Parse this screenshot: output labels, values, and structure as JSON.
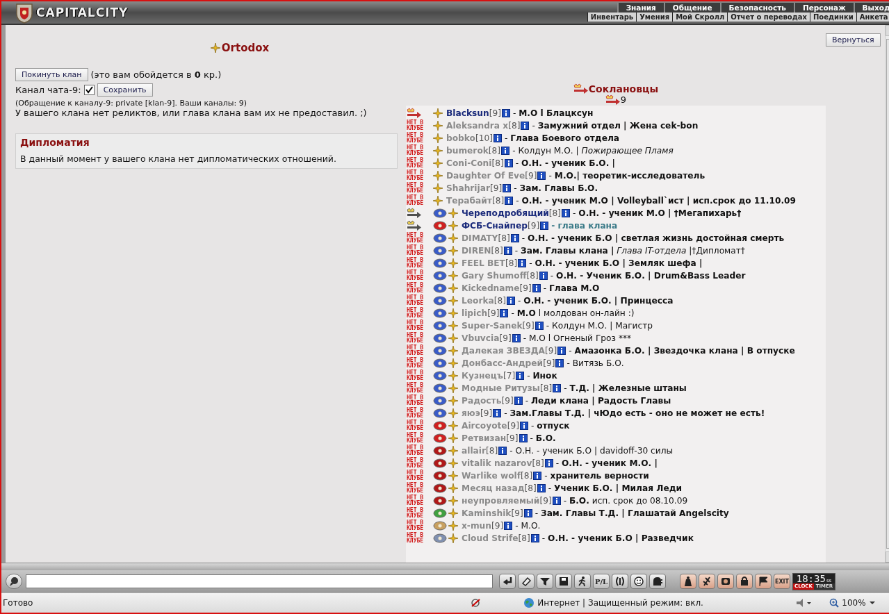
{
  "header": {
    "logo_text": "CAPITALCITY",
    "menu": [
      "Знания",
      "Общение",
      "Безопасность",
      "Персонаж",
      "Выход"
    ],
    "submenu": [
      "Инвентарь",
      "Умения",
      "Мой Скролл",
      "Отчет о переводах",
      "Поединки",
      "Анкета"
    ]
  },
  "return_button": "Вернуться",
  "clan": {
    "name": "Ortodox",
    "leave_button": "Покинуть клан",
    "leave_note": "(это вам обойдется в **0** кр.)",
    "channel_label": "Канал чата-9:",
    "channel_checked": true,
    "save_button": "Сохранить",
    "channel_note": "(Обращение к каналу-9: private [klan-9]. Ваши каналы: 9)",
    "relics_note": "У вашего клана нет реликтов, или глава клана вам их не предоставил. ;)"
  },
  "diplomacy": {
    "title": "Дипломатия",
    "text": "В данный момент у вашего клана нет дипломатических отношений."
  },
  "members_panel": {
    "title": "Соклановцы",
    "online_count": "9",
    "members": [
      {
        "name": "Blacksun",
        "lvl": "[9]",
        "desc": "- **М.О l Блацксун**",
        "online": true,
        "highlight": false
      },
      {
        "name": "Aleksandra x",
        "lvl": "[8]",
        "desc": "- **Замужний отдел | Жена cek-bon**",
        "online": false,
        "status": "НЕТ В КЛУБЕ",
        "highlight": false
      },
      {
        "name": "bobko",
        "lvl": "[10]",
        "desc": "- **Глава Боевого отдела**",
        "online": false,
        "status": "НЕТ В КЛУБЕ",
        "highlight": false
      },
      {
        "name": "bumerok",
        "lvl": "[8]",
        "desc": "- Колдун М.О. | *Пожирающее Пламя*",
        "online": false,
        "status": "НЕТ В КЛУБЕ",
        "highlight": false
      },
      {
        "name": "Coni-Coni",
        "lvl": "[8]",
        "desc": "- **О.Н. - ученик Б.О. |**",
        "online": false,
        "status": "НЕТ В КЛУБЕ",
        "highlight": false
      },
      {
        "name": "Daughter Of Eve",
        "lvl": "[9]",
        "desc": "- **М.О.| теоретик-исследователь**",
        "online": false,
        "status": "НЕТ В КЛУБЕ",
        "highlight": false
      },
      {
        "name": "Shahrijar",
        "lvl": "[9]",
        "desc": "- **Зам. Главы Б.О.**",
        "online": false,
        "status": "НЕТ В КЛУБЕ",
        "highlight": false
      },
      {
        "name": "Терабайт",
        "lvl": "[8]",
        "desc": "- **О.Н. - ученик М.О | Volleyball`ист | исп.срок до 11.10.09**",
        "online": false,
        "status": "НЕТ В КЛУБЕ",
        "highlight": false
      },
      {
        "name": "Череподробящий",
        "lvl": "[8]",
        "desc": "- **О.Н. - ученик М.О | †Мегапихарь†**",
        "online": true,
        "color": "#3a5cc8",
        "highlight": false
      },
      {
        "name": "ФСБ-Снайпер",
        "lvl": "[9]",
        "desc": "- глава клана",
        "online": true,
        "color": "#d02020",
        "highlight": true
      },
      {
        "name": "DIMATY",
        "lvl": "[8]",
        "desc": "- **О.Н. - ученик Б.О | светлая жизнь достойная смерть**",
        "online": false,
        "status": "НЕТ В КЛУБЕ",
        "color": "#3a5cc8",
        "highlight": false
      },
      {
        "name": "DIREN",
        "lvl": "[8]",
        "desc": "- **Зам. Главы клана |** *Глава IT-отдела* |†Дипломат†",
        "online": false,
        "status": "НЕТ В КЛУБЕ",
        "color": "#3a5cc8",
        "highlight": false
      },
      {
        "name": "FEEL BET",
        "lvl": "[8]",
        "desc": "- **О.Н. - ученик Б.О | Земляк шефа |**",
        "online": false,
        "status": "НЕТ В КЛУБЕ",
        "color": "#3a5cc8",
        "highlight": false
      },
      {
        "name": "Gary Shumoff",
        "lvl": "[8]",
        "desc": "- **О.Н. - Ученик Б.О. | Drum&Bass Leader**",
        "online": false,
        "status": "НЕТ В КЛУБЕ",
        "color": "#3a5cc8",
        "highlight": false
      },
      {
        "name": "Kickedname",
        "lvl": "[9]",
        "desc": "- **Глава М.О**",
        "online": false,
        "status": "НЕТ В КЛУБЕ",
        "color": "#3a5cc8",
        "highlight": false
      },
      {
        "name": "Leorka",
        "lvl": "[8]",
        "desc": "- **О.Н. - ученик Б.О. | Принцесса**",
        "online": false,
        "status": "НЕТ В КЛУБЕ",
        "color": "#3a5cc8",
        "highlight": false
      },
      {
        "name": "lipich",
        "lvl": "[9]",
        "desc": "- **М.О** l молдован он-лайн :)",
        "online": false,
        "status": "НЕТ В КЛУБЕ",
        "color": "#3a5cc8",
        "highlight": false
      },
      {
        "name": "Super-Sanek",
        "lvl": "[9]",
        "desc": "- Колдун М.О. | Магистр",
        "online": false,
        "status": "НЕТ В КЛУБЕ",
        "color": "#3a5cc8",
        "highlight": false
      },
      {
        "name": "Vbuvcia",
        "lvl": "[9]",
        "desc": "- М.О l Огненый Гроз ***",
        "online": false,
        "status": "НЕТ В КЛУБЕ",
        "color": "#3a5cc8",
        "highlight": false
      },
      {
        "name": "Далекая ЗВЕЗДА",
        "lvl": "[9]",
        "desc": "- **Амазонка Б.О. | Звездочка клана | В отпуске**",
        "online": false,
        "status": "НЕТ В КЛУБЕ",
        "color": "#3a5cc8",
        "highlight": false
      },
      {
        "name": "Донбасс-Андрей",
        "lvl": "[9]",
        "desc": "- Витязь Б.О.",
        "online": false,
        "status": "НЕТ В КЛУБЕ",
        "color": "#3a5cc8",
        "highlight": false
      },
      {
        "name": "Кузнецъ",
        "lvl": "[7]",
        "desc": "- **Инок**",
        "online": false,
        "status": "НЕТ В КЛУБЕ",
        "color": "#3a5cc8",
        "highlight": false
      },
      {
        "name": "Модные Ритузы",
        "lvl": "[8]",
        "desc": "- **Т.Д. | Железные штаны**",
        "online": false,
        "status": "НЕТ В КЛУБЕ",
        "color": "#3a5cc8",
        "highlight": false
      },
      {
        "name": "Радость",
        "lvl": "[9]",
        "desc": "- **Леди клана | Радость Главы**",
        "online": false,
        "status": "НЕТ В КЛУБЕ",
        "color": "#3a5cc8",
        "highlight": false
      },
      {
        "name": "яюэ",
        "lvl": "[9]",
        "desc": "- **Зам.Главы Т.Д. | чЮдо есть - оно не может не есть!**",
        "online": false,
        "status": "НЕТ В КЛУБЕ",
        "color": "#3a5cc8",
        "highlight": false
      },
      {
        "name": "Aircoyote",
        "lvl": "[9]",
        "desc": "- **отпуск**",
        "online": false,
        "status": "НЕТ В КЛУБЕ",
        "color": "#d02020",
        "highlight": false
      },
      {
        "name": "Ретвизан",
        "lvl": "[9]",
        "desc": "- **Б.О.**",
        "online": false,
        "status": "НЕТ В КЛУБЕ",
        "color": "#d02020",
        "highlight": false
      },
      {
        "name": "allair",
        "lvl": "[8]",
        "desc": "- О.Н. - ученик Б.О | davidoff-30 силы",
        "online": false,
        "status": "НЕТ В КЛУБЕ",
        "color": "#b01818",
        "highlight": false
      },
      {
        "name": "vitalik nazarov",
        "lvl": "[8]",
        "desc": "- **О.Н. - ученик М.О. |**",
        "online": false,
        "status": "НЕТ В КЛУБЕ",
        "color": "#b01818",
        "highlight": false
      },
      {
        "name": "Warlike wolf",
        "lvl": "[8]",
        "desc": "- **хранитель верности**",
        "online": false,
        "status": "НЕТ В КЛУБЕ",
        "color": "#b01818",
        "highlight": false
      },
      {
        "name": "Месяц назад",
        "lvl": "[8]",
        "desc": "- **Ученик Б.О. | Милая Леди**",
        "online": false,
        "status": "НЕТ В КЛУБЕ",
        "color": "#b01818",
        "highlight": false
      },
      {
        "name": "неупровляемый",
        "lvl": "[9]",
        "desc": "- **Б.О.** исп. срок до 08.10.09",
        "online": false,
        "status": "НЕТ В КЛУБЕ",
        "color": "#b01818",
        "highlight": false
      },
      {
        "name": "Kaminshik",
        "lvl": "[9]",
        "desc": "- **Зам. Главы Т.Д. | Глашатай Angelscity**",
        "online": false,
        "status": "НЕТ В КЛУБЕ",
        "color": "#40a040",
        "highlight": false
      },
      {
        "name": "x-mun",
        "lvl": "[9]",
        "desc": "- М.О.",
        "online": false,
        "status": "НЕТ В КЛУБЕ",
        "color": "#c8a060",
        "highlight": false
      },
      {
        "name": "Cloud Strife",
        "lvl": "[8]",
        "desc": "- **О.Н. - ученик Б.О | Разведчик**",
        "online": false,
        "status": "НЕТ В КЛУБЕ",
        "color": "#8090b0",
        "highlight": false
      }
    ]
  },
  "chat_bar": {
    "pl_label": "P/L",
    "exit_label": "EXIT",
    "clock": "18:35",
    "clock_seconds": "ss",
    "clock_label": "CLOCK",
    "timer_label": "TIMER"
  },
  "status_bar": {
    "status": "Готово",
    "zone": "Интернет | Защищенный режим: вкл.",
    "zoom": "100%"
  }
}
